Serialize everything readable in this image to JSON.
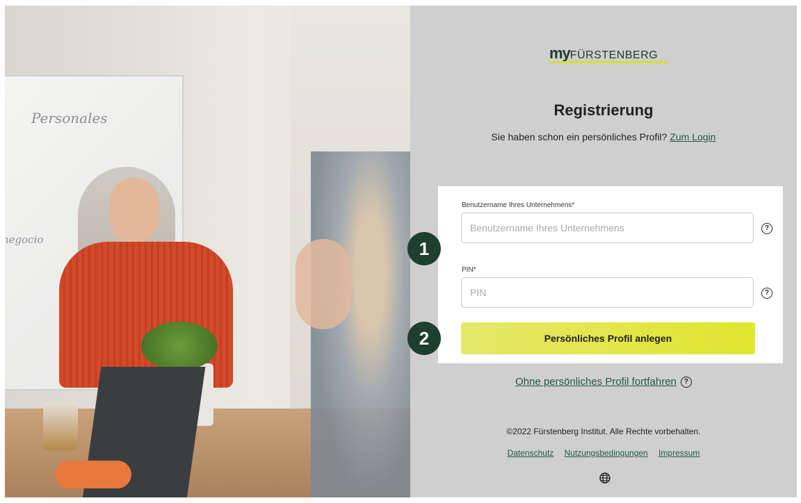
{
  "brand": {
    "logo_my": "my",
    "logo_name": "FÜRSTENBERG"
  },
  "page": {
    "title": "Registrierung",
    "subtitle_text": "Sie haben schon ein persönliches Profil? ",
    "login_link": "Zum Login"
  },
  "form": {
    "company_label": "Benutzername Ihres Unternehmens*",
    "company_placeholder": "Benutzername Ihres Unternehmens",
    "pin_label": "PIN*",
    "pin_placeholder": "PIN",
    "help_symbol": "?",
    "submit_label": "Persönliches Profil anlegen"
  },
  "badges": {
    "step1": "1",
    "step2": "2"
  },
  "guest": {
    "link": "Ohne persönliches Profil fortfahren",
    "help_symbol": "?"
  },
  "footer": {
    "copyright": "©2022 Fürstenberg Institut. Alle Rechte vorbehalten.",
    "links": [
      "Datenschutz",
      "Nutzungsbedingungen",
      "Impressum"
    ],
    "language_icon": "globe-icon"
  },
  "photo": {
    "whiteboard_text_1": "Personales",
    "whiteboard_text_2": "negocio"
  },
  "colors": {
    "accent": "#1f3f30",
    "button": "#e1e52e",
    "link": "#1e5b4a",
    "panel_bg": "#cfcfcf"
  }
}
